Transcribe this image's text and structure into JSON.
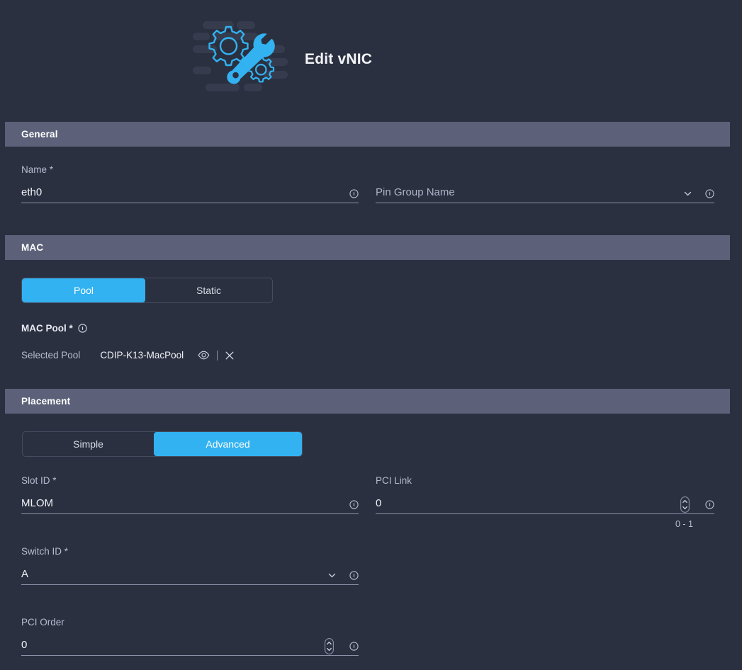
{
  "header": {
    "title": "Edit vNIC",
    "illustration_icon": "gear-wrench-icon"
  },
  "sections": {
    "general": {
      "title": "General",
      "fields": {
        "name": {
          "label": "Name *",
          "value": "eth0",
          "info_icon": "info-icon"
        },
        "pin_group_name": {
          "label": "",
          "placeholder": "Pin Group Name",
          "value": "",
          "dropdown_icon": "chevron-down-icon",
          "info_icon": "info-icon"
        }
      }
    },
    "mac": {
      "title": "MAC",
      "toggle": {
        "options": [
          "Pool",
          "Static"
        ],
        "selected": "Pool"
      },
      "mac_pool_label": "MAC Pool *",
      "mac_pool_info_icon": "info-icon",
      "selected_pool_caption": "Selected Pool",
      "selected_pool_value": "CDIP-K13-MacPool",
      "actions": {
        "view_icon": "eye-icon",
        "clear_icon": "close-icon"
      }
    },
    "placement": {
      "title": "Placement",
      "toggle": {
        "options": [
          "Simple",
          "Advanced"
        ],
        "selected": "Advanced"
      },
      "fields": {
        "slot_id": {
          "label": "Slot ID *",
          "value": "MLOM",
          "info_icon": "info-icon"
        },
        "pci_link": {
          "label": "PCI Link",
          "value": "0",
          "helper": "0 - 1",
          "spinner_icon": "number-stepper-icon",
          "info_icon": "info-icon"
        },
        "switch_id": {
          "label": "Switch ID *",
          "value": "A",
          "dropdown_icon": "chevron-down-icon",
          "info_icon": "info-icon"
        },
        "pci_order": {
          "label": "PCI Order",
          "value": "0",
          "spinner_icon": "number-stepper-icon",
          "info_icon": "info-icon"
        }
      }
    }
  },
  "colors": {
    "background": "#2b3040",
    "section_bar": "#5c6179",
    "accent": "#32b2f1",
    "underline": "#8b91a8",
    "label_text": "#b6bcd0",
    "value_text": "#f0f2f7"
  }
}
